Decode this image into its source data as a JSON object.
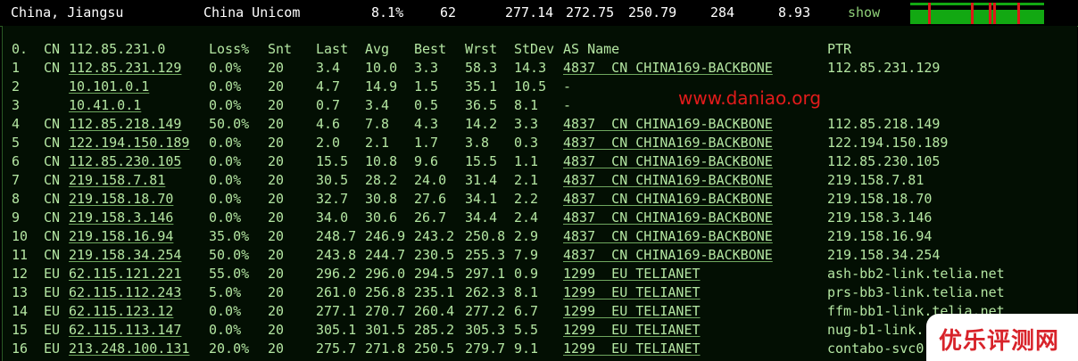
{
  "summary": {
    "location": "China, Jiangsu",
    "isp": "China Unicom",
    "loss": "8.1%",
    "sent": "62",
    "last": "277.14",
    "avg": "272.75",
    "best": "250.79",
    "worst": "284",
    "stdev": "8.93",
    "show_label": "show"
  },
  "header": {
    "hop": "0.",
    "cc": "CN",
    "host": "112.85.231.0",
    "loss": "Loss%",
    "snt": "Snt",
    "last": "Last",
    "avg": "Avg",
    "best": "Best",
    "wrst": "Wrst",
    "stdev": "StDev",
    "asname": "AS Name",
    "ptr": "PTR"
  },
  "hops": [
    {
      "hop": "1",
      "cc": "CN",
      "ip": "112.85.231.129",
      "loss": "0.0%",
      "snt": "20",
      "last": "3.4",
      "avg": "10.0",
      "best": "3.3",
      "wrst": "58.3",
      "stdev": "14.3",
      "as": "4837  CN CHINA169-BACKBONE",
      "ptr": "112.85.231.129"
    },
    {
      "hop": "2",
      "cc": "",
      "ip": "10.101.0.1",
      "loss": "0.0%",
      "snt": "20",
      "last": "4.7",
      "avg": "14.9",
      "best": "1.5",
      "wrst": "35.1",
      "stdev": "10.5",
      "as": "-",
      "ptr": ""
    },
    {
      "hop": "3",
      "cc": "",
      "ip": "10.41.0.1",
      "loss": "0.0%",
      "snt": "20",
      "last": "0.7",
      "avg": "3.4",
      "best": "0.5",
      "wrst": "36.5",
      "stdev": "8.1",
      "as": "-",
      "ptr": ""
    },
    {
      "hop": "4",
      "cc": "CN",
      "ip": "112.85.218.149",
      "loss": "50.0%",
      "snt": "20",
      "last": "4.6",
      "avg": "7.8",
      "best": "4.3",
      "wrst": "14.2",
      "stdev": "3.3",
      "as": "4837  CN CHINA169-BACKBONE",
      "ptr": "112.85.218.149"
    },
    {
      "hop": "5",
      "cc": "CN",
      "ip": "122.194.150.189",
      "loss": "0.0%",
      "snt": "20",
      "last": "2.0",
      "avg": "2.1",
      "best": "1.7",
      "wrst": "3.8",
      "stdev": "0.3",
      "as": "4837  CN CHINA169-BACKBONE",
      "ptr": "122.194.150.189"
    },
    {
      "hop": "6",
      "cc": "CN",
      "ip": "112.85.230.105",
      "loss": "0.0%",
      "snt": "20",
      "last": "15.5",
      "avg": "10.8",
      "best": "9.6",
      "wrst": "15.5",
      "stdev": "1.1",
      "as": "4837  CN CHINA169-BACKBONE",
      "ptr": "112.85.230.105"
    },
    {
      "hop": "7",
      "cc": "CN",
      "ip": "219.158.7.81",
      "loss": "0.0%",
      "snt": "20",
      "last": "30.5",
      "avg": "28.2",
      "best": "24.0",
      "wrst": "31.4",
      "stdev": "2.1",
      "as": "4837  CN CHINA169-BACKBONE",
      "ptr": "219.158.7.81"
    },
    {
      "hop": "8",
      "cc": "CN",
      "ip": "219.158.18.70",
      "loss": "0.0%",
      "snt": "20",
      "last": "32.7",
      "avg": "30.8",
      "best": "27.6",
      "wrst": "34.1",
      "stdev": "2.2",
      "as": "4837  CN CHINA169-BACKBONE",
      "ptr": "219.158.18.70"
    },
    {
      "hop": "9",
      "cc": "CN",
      "ip": "219.158.3.146",
      "loss": "0.0%",
      "snt": "20",
      "last": "34.0",
      "avg": "30.6",
      "best": "26.7",
      "wrst": "34.4",
      "stdev": "2.4",
      "as": "4837  CN CHINA169-BACKBONE",
      "ptr": "219.158.3.146"
    },
    {
      "hop": "10",
      "cc": "CN",
      "ip": "219.158.16.94",
      "loss": "35.0%",
      "snt": "20",
      "last": "248.7",
      "avg": "246.9",
      "best": "243.2",
      "wrst": "250.8",
      "stdev": "2.9",
      "as": "4837  CN CHINA169-BACKBONE",
      "ptr": "219.158.16.94"
    },
    {
      "hop": "11",
      "cc": "CN",
      "ip": "219.158.34.254",
      "loss": "50.0%",
      "snt": "20",
      "last": "243.8",
      "avg": "244.7",
      "best": "230.5",
      "wrst": "255.3",
      "stdev": "7.9",
      "as": "4837  CN CHINA169-BACKBONE",
      "ptr": "219.158.34.254"
    },
    {
      "hop": "12",
      "cc": "EU",
      "ip": "62.115.121.221",
      "loss": "55.0%",
      "snt": "20",
      "last": "296.2",
      "avg": "296.0",
      "best": "294.5",
      "wrst": "297.1",
      "stdev": "0.9",
      "as": "1299  EU TELIANET",
      "ptr": "ash-bb2-link.telia.net"
    },
    {
      "hop": "13",
      "cc": "EU",
      "ip": "62.115.112.243",
      "loss": "5.0%",
      "snt": "20",
      "last": "261.0",
      "avg": "256.8",
      "best": "235.1",
      "wrst": "262.3",
      "stdev": "8.1",
      "as": "1299  EU TELIANET",
      "ptr": "prs-bb3-link.telia.net"
    },
    {
      "hop": "14",
      "cc": "EU",
      "ip": "62.115.123.12",
      "loss": "0.0%",
      "snt": "20",
      "last": "277.1",
      "avg": "270.7",
      "best": "260.4",
      "wrst": "277.2",
      "stdev": "6.7",
      "as": "1299  EU TELIANET",
      "ptr": "ffm-bb1-link.telia.net"
    },
    {
      "hop": "15",
      "cc": "EU",
      "ip": "62.115.113.147",
      "loss": "0.0%",
      "snt": "20",
      "last": "305.1",
      "avg": "301.5",
      "best": "285.2",
      "wrst": "305.3",
      "stdev": "5.5",
      "as": "1299  EU TELIANET",
      "ptr": "nug-b1-link."
    },
    {
      "hop": "16",
      "cc": "EU",
      "ip": "213.248.100.131",
      "loss": "20.0%",
      "snt": "20",
      "last": "275.7",
      "avg": "271.8",
      "best": "250.5",
      "wrst": "279.7",
      "stdev": "9.1",
      "as": "1299  EU TELIANET",
      "ptr": "contabo-svc0"
    }
  ],
  "watermark": "www.daniao.org",
  "badge": "优乐评测网",
  "colors": {
    "text": "#b4e6a2",
    "background": "#030f03",
    "spark_green": "#12a812",
    "spark_red": "#e01818",
    "watermark": "#e21b1b"
  }
}
